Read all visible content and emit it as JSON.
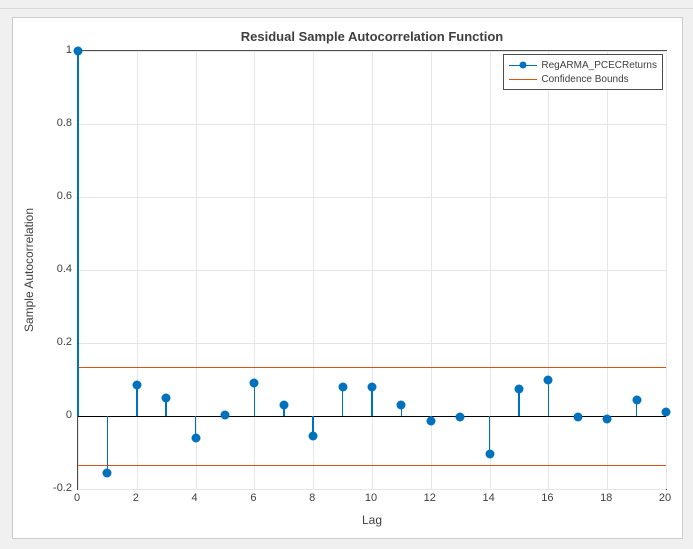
{
  "chart_data": {
    "type": "stem",
    "title": "Residual Sample Autocorrelation Function",
    "xlabel": "Lag",
    "ylabel": "Sample Autocorrelation",
    "xlim": [
      0,
      20
    ],
    "ylim": [
      -0.2,
      1.0
    ],
    "xticks": [
      0,
      2,
      4,
      6,
      8,
      10,
      12,
      14,
      16,
      18,
      20
    ],
    "yticks": [
      -0.2,
      0,
      0.2,
      0.4,
      0.6,
      0.8,
      1.0
    ],
    "ytick_labels": [
      "-0.2",
      "0",
      "0.2",
      "0.4",
      "0.6",
      "0.8",
      "1"
    ],
    "confidence_bounds": [
      0.135,
      -0.135
    ],
    "series": [
      {
        "name": "RegARMA_PCECReturns",
        "x": [
          0,
          1,
          2,
          3,
          4,
          5,
          6,
          7,
          8,
          9,
          10,
          11,
          12,
          13,
          14,
          15,
          16,
          17,
          18,
          19,
          20
        ],
        "y": [
          1.0,
          -0.155,
          0.085,
          0.05,
          -0.06,
          0.003,
          0.09,
          0.03,
          -0.055,
          0.08,
          0.08,
          0.03,
          -0.015,
          -0.003,
          -0.105,
          0.075,
          0.1,
          -0.003,
          -0.007,
          0.045,
          0.012
        ]
      }
    ],
    "legend": {
      "entries": [
        "RegARMA_PCECReturns",
        "Confidence Bounds"
      ],
      "position": "northeast"
    }
  }
}
